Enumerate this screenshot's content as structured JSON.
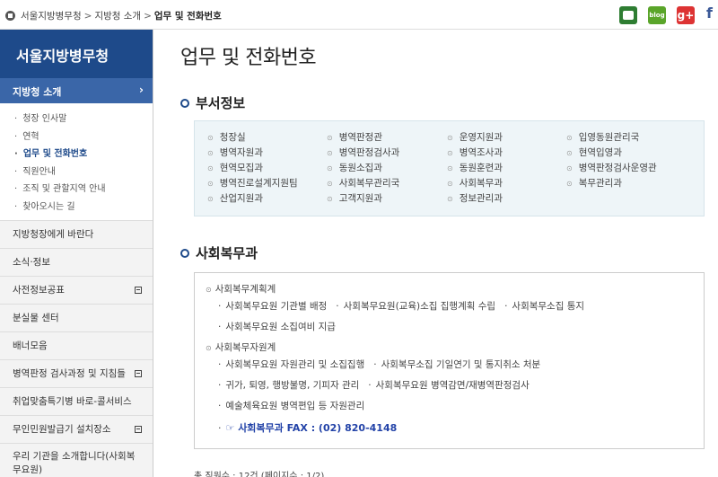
{
  "breadcrumb": {
    "items": [
      "서울지방병무청",
      "지방청 소개",
      "업무 및 전화번호"
    ],
    "separator": ">"
  },
  "sns": {
    "blog": "blog",
    "gplus": "g+",
    "facebook": "f"
  },
  "sidebar": {
    "title": "서울지방병무청",
    "active": "지방청 소개",
    "sub_items": [
      "청장 인사말",
      "연혁",
      "업무 및 전화번호",
      "직원안내",
      "조직 및 관할지역 안내",
      "찾아오시는 길"
    ],
    "menu": [
      {
        "label": "지방청장에게 바란다",
        "expand": false
      },
      {
        "label": "소식·정보",
        "expand": false
      },
      {
        "label": "사전정보공표",
        "expand": true
      },
      {
        "label": "분실물 센터",
        "expand": false
      },
      {
        "label": "배너모음",
        "expand": false
      },
      {
        "label": "병역판정 검사과정 및 지침들",
        "expand": true
      },
      {
        "label": "취업맞춤특기병 바로-콜서비스",
        "expand": false
      },
      {
        "label": "무인민원발급기 설치장소",
        "expand": true
      },
      {
        "label": "우리 기관을 소개합니다(사회복무요원)",
        "expand": false
      }
    ]
  },
  "main": {
    "title": "업무 및 전화번호",
    "dept_section_title": "부서정보",
    "departments": [
      [
        "청장실",
        "병역판정관",
        "운영지원과",
        "입영동원관리국"
      ],
      [
        "병역자원과",
        "병역판정검사과",
        "병역조사과",
        "현역입영과"
      ],
      [
        "현역모집과",
        "동원소집과",
        "동원훈련과",
        "병역판정검사운영관"
      ],
      [
        "병역진로설계지원팀",
        "사회복무관리국",
        "사회복무과",
        "복무관리과"
      ],
      [
        "산업지원과",
        "고객지원과",
        "정보관리과"
      ]
    ],
    "social_section_title": "사회복무과",
    "groups": [
      {
        "name": "사회복무계획계",
        "lines": [
          [
            "사회복무요원 기관별 배정",
            "사회복무요원(교육)소집 집행계획 수립",
            "사회복무소집 통지"
          ],
          [
            "사회복무요원 소집여비 지급"
          ]
        ]
      },
      {
        "name": "사회복무자원계",
        "lines": [
          [
            "사회복무요원 자원관리 및 소집집행",
            "사회복무소집 기일연기 및 통지취소 처분"
          ],
          [
            "귀가, 퇴영, 행방불명, 기피자 관리",
            "사회복무요원 병역감면/재병역판정검사"
          ],
          [
            "예술체육요원 병역편입 등 자원관리"
          ]
        ]
      }
    ],
    "fax": "☞ 사회복무과 FAX : (02) 820-4148",
    "footer": "총 직원수 : 12건 (페이지수 : 1/2)"
  }
}
